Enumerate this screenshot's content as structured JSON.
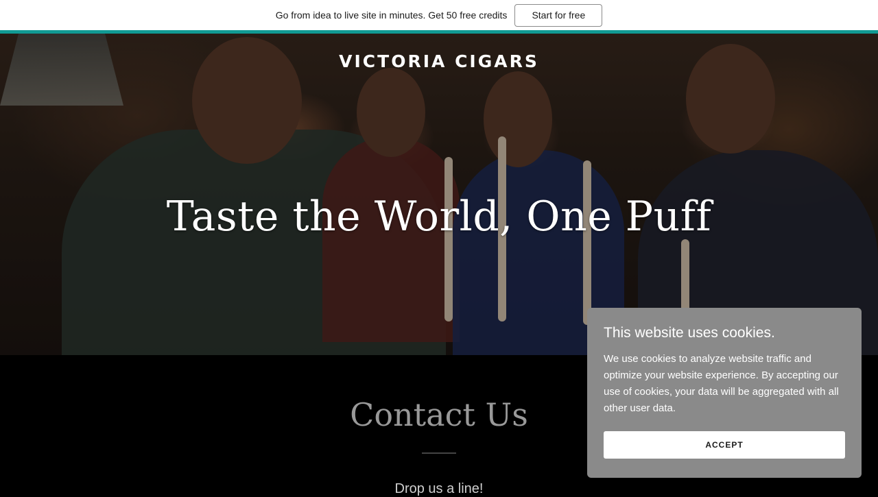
{
  "promo": {
    "text": "Go from idea to live site in minutes. Get 50 free credits",
    "button_label": "Start for free",
    "accent_color": "#119a94"
  },
  "hero": {
    "brand": "VICTORIA CIGARS",
    "title": "Taste the World, One Puff",
    "image_description_icon": "hero-photo"
  },
  "contact": {
    "title": "Contact Us",
    "subtitle": "Drop us a line!"
  },
  "cookie_banner": {
    "title": "This website uses cookies.",
    "body": "We use cookies to analyze website traffic and optimize your website experience. By accepting our use of cookies, your data will be aggregated with all other user data.",
    "accept_label": "ACCEPT",
    "background_color": "#8a8a8a"
  }
}
